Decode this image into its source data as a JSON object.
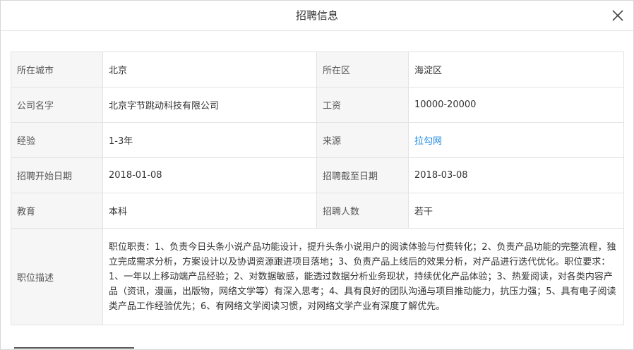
{
  "dialog": {
    "title": "招聘信息"
  },
  "rows": [
    {
      "label1": "所在城市",
      "value1": "北京",
      "label2": "所在区",
      "value2": "海淀区"
    },
    {
      "label1": "公司名字",
      "value1": "北京字节跳动科技有限公司",
      "label2": "工资",
      "value2": "10000-20000"
    },
    {
      "label1": "经验",
      "value1": "1-3年",
      "label2": "来源",
      "value2": "拉勾网"
    },
    {
      "label1": "招聘开始日期",
      "value1": "2018-01-08",
      "label2": "招聘截至日期",
      "value2": "2018-03-08"
    },
    {
      "label1": "教育",
      "value1": "本科",
      "label2": "招聘人数",
      "value2": "若干"
    }
  ],
  "description": {
    "label": "职位描述",
    "text": "职位职责：1、负责今日头条小说产品功能设计，提升头条小说用户的阅读体验与付费转化；2、负责产品功能的完整流程，独立完成需求分析，方案设计以及协调资源跟进项目落地；3、负责产品上线后的效果分析，对产品进行迭代优化。职位要求：1、一年以上移动端产品经验；2、对数据敏感，能透过数据分析业务现状，持续优化产品体验；3、热爱阅读，对各类内容产品（资讯，漫画，出版物，网络文学等）有深入思考；4、具有良好的团队沟通与项目推动能力，抗压力强；5、具有电子阅读类产品工作经验优先；6、有网络文学阅读习惯，对网络文学产业有深度了解优先。"
  },
  "colors": {
    "link": "#1e88e5",
    "label_bg": "#f6f6f6",
    "border": "#e3e3e3"
  },
  "icons": {
    "close": "close-icon"
  }
}
